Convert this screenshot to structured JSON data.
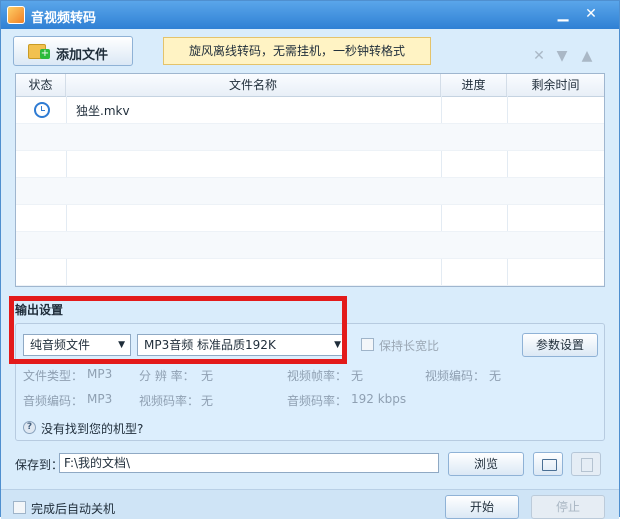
{
  "window": {
    "title": "音视频转码"
  },
  "toolbar": {
    "add_file_label": "添加文件",
    "banner_text": "旋风离线转码，无需挂机，一秒钟转格式"
  },
  "table": {
    "headers": [
      "状态",
      "文件名称",
      "进度",
      "剩余时间"
    ],
    "rows": [
      {
        "status_icon": "clock-icon",
        "name": "独坐.mkv",
        "progress": "",
        "remaining": ""
      }
    ]
  },
  "output": {
    "section_title": "输出设置",
    "format_select": "纯音频文件",
    "quality_select": "MP3音频 标准品质192K",
    "keep_ratio_label": "保持长宽比",
    "params_button": "参数设置",
    "file_type_label": "文件类型：",
    "file_type_value": "MP3",
    "resolution_label": "分 辨 率：",
    "resolution_value": "无",
    "video_fps_label": "视频帧率：",
    "video_fps_value": "无",
    "video_codec_label": "视频编码：",
    "video_codec_value": "无",
    "audio_codec_label": "音频编码：",
    "audio_codec_value": "MP3",
    "video_bitrate_label": "视频码率：",
    "video_bitrate_value": "无",
    "audio_bitrate_label": "音频码率：",
    "audio_bitrate_value": "192 kbps",
    "help_text": "没有找到您的机型?"
  },
  "save": {
    "label": "保存到：",
    "path": "F:\\我的文档\\",
    "browse_button": "浏览"
  },
  "footer": {
    "shutdown_label": "完成后自动关机",
    "start_button": "开始",
    "stop_button": "停止"
  },
  "colors": {
    "title_bar": "#2f80d4",
    "annotation_border": "#e31a1a",
    "banner_bg": "#fff3c4"
  }
}
